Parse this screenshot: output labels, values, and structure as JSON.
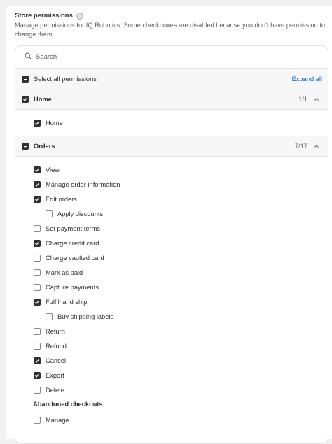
{
  "header": {
    "title": "Store permissions",
    "info_icon": "info-circle-icon",
    "description": "Manage permissions for IQ Robotics. Some checkboxes are disabled because you don't have permission to change them."
  },
  "search": {
    "placeholder": "Search",
    "value": "",
    "icon": "search-icon"
  },
  "select_all": {
    "label": "Select all permissions",
    "state": "indeterminate",
    "expand_label": "Expand all"
  },
  "sections": [
    {
      "name": "Home",
      "state": "checked",
      "count": "1/1",
      "expanded": true,
      "items": [
        {
          "label": "Home",
          "checked": true
        }
      ]
    },
    {
      "name": "Orders",
      "state": "indeterminate",
      "count": "7/17",
      "expanded": true,
      "items": [
        {
          "label": "View",
          "checked": true
        },
        {
          "label": "Manage order information",
          "checked": true
        },
        {
          "label": "Edit orders",
          "checked": true
        },
        {
          "label": "Apply discounts",
          "checked": false
        },
        {
          "label": "Set payment terms",
          "checked": false
        },
        {
          "label": "Charge credit card",
          "checked": true
        },
        {
          "label": "Charge vaulted card",
          "checked": false
        },
        {
          "label": "Mark as paid",
          "checked": false
        },
        {
          "label": "Capture payments",
          "checked": false
        },
        {
          "label": "Fulfill and ship",
          "checked": true
        },
        {
          "label": "Buy shipping labels",
          "checked": false
        },
        {
          "label": "Return",
          "checked": false
        },
        {
          "label": "Refund",
          "checked": false
        },
        {
          "label": "Cancel",
          "checked": true
        },
        {
          "label": "Export",
          "checked": true
        },
        {
          "label": "Delete",
          "checked": false
        }
      ],
      "subgroup": {
        "title": "Abandoned checkouts",
        "items": [
          {
            "label": "Manage",
            "checked": false
          }
        ]
      }
    }
  ],
  "colors": {
    "link": "#005bd3",
    "checkbox_fill": "#303030",
    "text": "#303030",
    "muted": "#616161",
    "section_bg": "#f7f7f7"
  }
}
